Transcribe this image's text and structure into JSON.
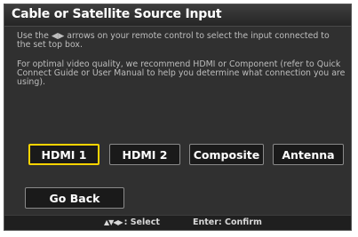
{
  "dialog": {
    "title": "Cable or Satellite Source Input",
    "instruction_prefix": "Use the ",
    "instruction_arrows": "◀▶",
    "instruction_suffix": " arrows on your remote control to select the input connected to the set top box.",
    "recommendation": "For optimal video quality, we recommend HDMI or Component (refer to Quick Connect Guide or User Manual to help you determine what connection you are using)."
  },
  "sources": [
    {
      "label": "HDMI 1",
      "selected": true
    },
    {
      "label": "HDMI 2",
      "selected": false
    },
    {
      "label": "Composite",
      "selected": false
    },
    {
      "label": "Antenna",
      "selected": false
    }
  ],
  "back_button": {
    "label": "Go Back"
  },
  "footer": {
    "select_icons": "▲▼◀▶",
    "select_label": ": Select",
    "confirm_label": "Enter: Confirm"
  },
  "colors": {
    "selection_border": "#ffd400",
    "background": "#303030"
  }
}
